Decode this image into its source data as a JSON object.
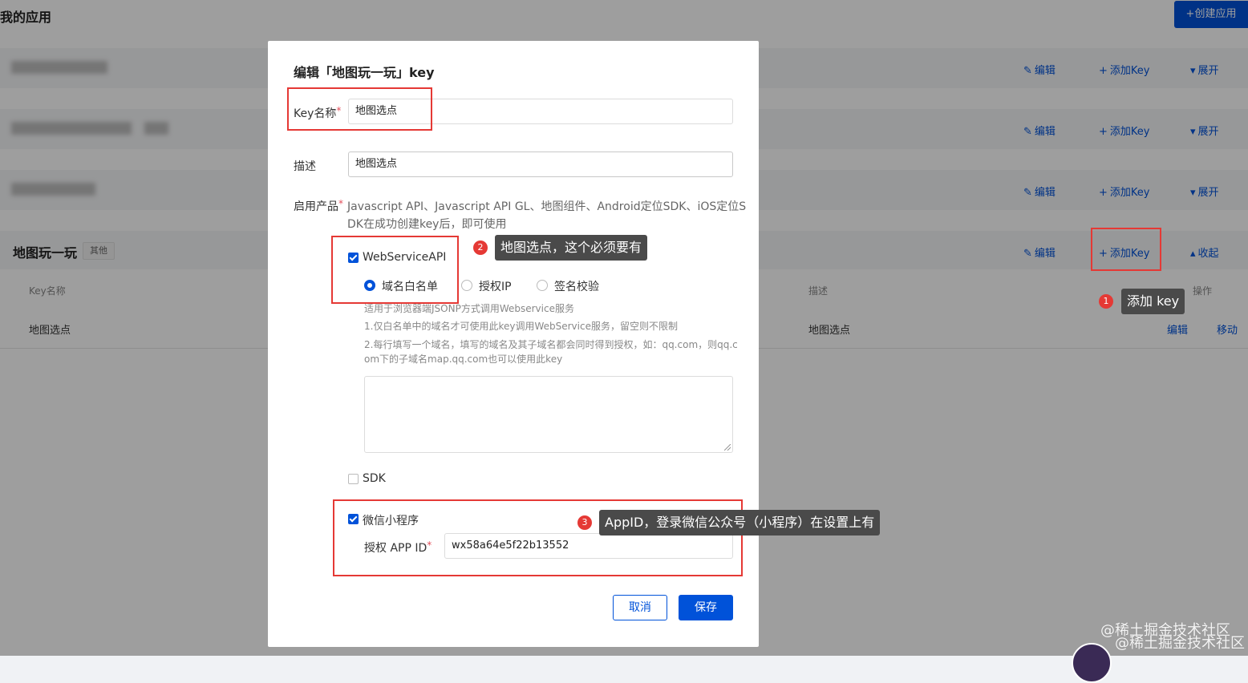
{
  "page": {
    "title": "我的应用",
    "create_button": "+创建应用"
  },
  "row_actions": {
    "edit": "编辑",
    "add_key": "添加Key",
    "expand": "展开",
    "collapse": "收起"
  },
  "app": {
    "name": "地图玩一玩",
    "tag": "其他",
    "table": {
      "headers": [
        "Key名称",
        "描述",
        "操作"
      ],
      "rows": [
        {
          "name": "地图选点",
          "desc": "地图选点",
          "actions": [
            "编辑",
            "移动"
          ]
        }
      ]
    }
  },
  "modal": {
    "title": "编辑「地图玩一玩」key",
    "key_name_label": "Key名称",
    "key_name_value": "地图选点",
    "desc_label": "描述",
    "desc_value": "地图选点",
    "products_label": "启用产品",
    "products_hint_line1": "Javascript API、Javascript API GL、地图组件、Android定位SDK、iOS定位S",
    "products_hint_line2": "DK在成功创建key后，即可使用",
    "webservice": {
      "label": "WebServiceAPI",
      "checked": true,
      "options": [
        "域名白名单",
        "授权IP",
        "签名校验"
      ],
      "selected": "域名白名单",
      "help": [
        "适用于浏览器端JSONP方式调用Webservice服务",
        "1.仅白名单中的域名才可使用此key调用WebService服务，留空则不限制",
        "2.每行填写一个域名，填写的域名及其子域名都会同时得到授权，如：qq.com，则qq.c",
        "om下的子域名map.qq.com也可以使用此key"
      ]
    },
    "sdk": {
      "label": "SDK",
      "checked": false
    },
    "wechat": {
      "label": "微信小程序",
      "checked": true,
      "appid_label": "授权 APP ID",
      "appid_value": "wx58a64e5f22b13552"
    },
    "cancel": "取消",
    "save": "保存"
  },
  "annotations": [
    {
      "num": "1",
      "text": "添加 key"
    },
    {
      "num": "2",
      "text": "地图选点，这个必须要有"
    },
    {
      "num": "3",
      "text": "AppID，登录微信公众号（小程序）在设置上有"
    }
  ],
  "watermark": "@稀土掘金技术社区",
  "colors": {
    "primary": "#0052d9",
    "annotation_red": "#e53935"
  }
}
